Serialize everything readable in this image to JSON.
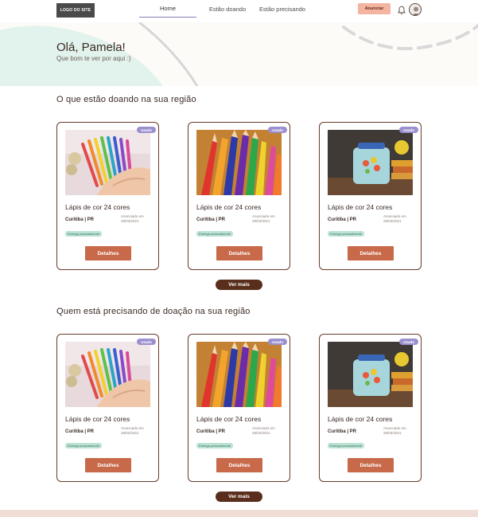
{
  "header": {
    "logo": "LOGO DO SITE",
    "nav": [
      "Home",
      "Estão doando",
      "Estão precisando"
    ],
    "cta": "Anunciar"
  },
  "hero": {
    "greeting": "Olá, Pamela!",
    "subtitle": "Que bom te ver por aqui :)"
  },
  "donating": {
    "title": "O que estão doando na sua região",
    "more": "Ver mais",
    "cards": [
      {
        "badge": "Usado",
        "title": "Lápis de cor 24 cores",
        "location": "Curitiba | PR",
        "date": "Anunciado em 28/03/2021",
        "tag": "Entrega pessoalmente",
        "button": "Detalhes",
        "image": "colored-pens-photo"
      },
      {
        "badge": "Usado",
        "title": "Lápis de cor 24 cores",
        "location": "Curitiba | PR",
        "date": "Anunciado em 28/03/2021",
        "tag": "Entrega pessoalmente",
        "button": "Detalhes",
        "image": "colored-pencils-photo"
      },
      {
        "badge": "Usado",
        "title": "Lápis de cor 24 cores",
        "location": "Curitiba | PR",
        "date": "Anunciado em 28/03/2021",
        "tag": "Entrega pessoalmente",
        "button": "Detalhes",
        "image": "lunchbox-photo"
      }
    ]
  },
  "needing": {
    "title": "Quem está precisando de doação na sua região",
    "more": "Ver mais",
    "cards": [
      {
        "badge": "Usado",
        "title": "Lápis de cor 24 cores",
        "location": "Curitiba | PR",
        "date": "Anunciado em 28/03/2021",
        "tag": "Entrega pessoalmente",
        "button": "Detalhes",
        "image": "colored-pens-photo"
      },
      {
        "badge": "Usado",
        "title": "Lápis de cor 24 cores",
        "location": "Curitiba | PR",
        "date": "Anunciado em 28/03/2021",
        "tag": "Entrega pessoalmente",
        "button": "Detalhes",
        "image": "colored-pencils-photo"
      },
      {
        "badge": "Usado",
        "title": "Lápis de cor 24 cores",
        "location": "Curitiba | PR",
        "date": "Anunciado em 28/03/2021",
        "tag": "Entrega pessoalmente",
        "button": "Detalhes",
        "image": "lunchbox-photo"
      }
    ]
  },
  "colors": {
    "accent": "#c8694a",
    "dark_brown": "#5a2e1c",
    "badge": "#9b8fce",
    "tag": "#b9e3d3",
    "cta": "#f3b4a2"
  }
}
